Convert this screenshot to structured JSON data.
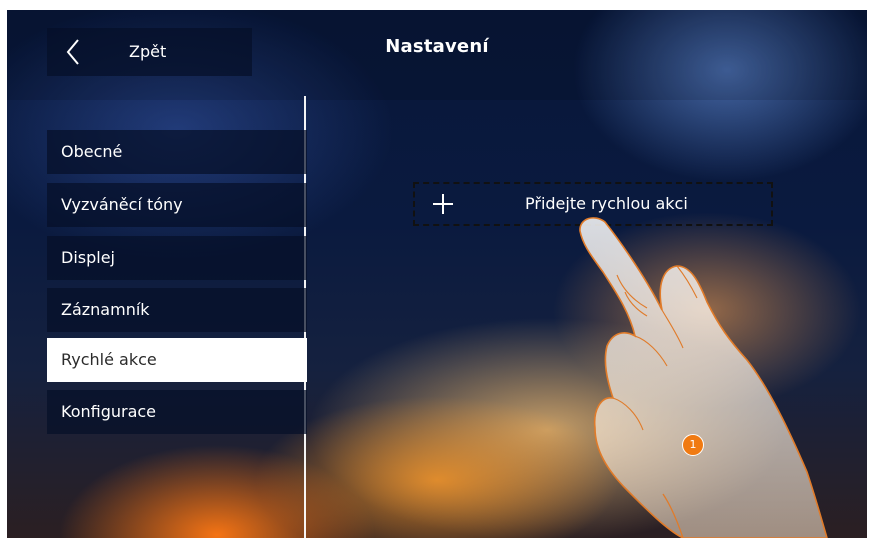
{
  "header": {
    "back_label": "Zpět",
    "title": "Nastavení"
  },
  "sidebar": {
    "items": [
      {
        "label": "Obecné",
        "active": false
      },
      {
        "label": "Vyzváněcí tóny",
        "active": false
      },
      {
        "label": "Displej",
        "active": false
      },
      {
        "label": "Záznamník",
        "active": false
      },
      {
        "label": "Rychlé akce",
        "active": true
      },
      {
        "label": "Konfigurace",
        "active": false
      }
    ]
  },
  "main": {
    "add_quick_action_label": "Přidejte rychlou akci"
  },
  "annotation": {
    "step_badge": "1"
  },
  "colors": {
    "badge": "#f07a12",
    "active_item_bg": "#ffffff",
    "item_bg": "#0a1430"
  },
  "icons": {
    "back": "chevron-left-icon",
    "add": "plus-icon",
    "pointer": "hand-pointer-icon"
  }
}
